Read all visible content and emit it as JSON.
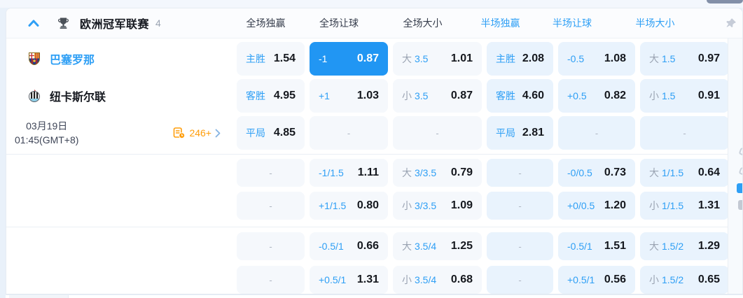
{
  "colors": {
    "accent_blue": "#2E9FF5",
    "selected_cell_bg": "#2196F3",
    "full_cell_bg": "#F5F8FC",
    "half_cell_bg": "#E9F3FD",
    "odds_text": "#15181E",
    "gray_label": "#9AA3B2",
    "orange": "#FF9D0A"
  },
  "league_header": {
    "title": "欧洲冠军联赛",
    "count": "4",
    "columns": [
      {
        "label": "全场独赢"
      },
      {
        "label": "全场让球"
      },
      {
        "label": "全场大小"
      },
      {
        "label": "半场独赢"
      },
      {
        "label": "半场让球"
      },
      {
        "label": "半场大小"
      }
    ]
  },
  "match": {
    "home_team": "巴塞罗那",
    "away_team": "纽卡斯尔联",
    "date": "03月19日",
    "time": "01:45(GMT+8)",
    "more_markets": "246+"
  },
  "odds": {
    "groups": [
      {
        "rows": [
          {
            "cells": [
              {
                "label": "主胜",
                "odds": "1.54"
              },
              {
                "label": "-1",
                "odds": "0.87",
                "selected": true
              },
              {
                "prefix": "大",
                "line": "3.5",
                "odds": "1.01"
              },
              {
                "label": "主胜",
                "odds": "2.08"
              },
              {
                "label": "-0.5",
                "odds": "1.08"
              },
              {
                "prefix": "大",
                "line": "1.5",
                "odds": "0.97"
              }
            ]
          },
          {
            "cells": [
              {
                "label": "客胜",
                "odds": "4.95"
              },
              {
                "label": "+1",
                "odds": "1.03"
              },
              {
                "prefix": "小",
                "line": "3.5",
                "odds": "0.87"
              },
              {
                "label": "客胜",
                "odds": "4.60"
              },
              {
                "label": "+0.5",
                "odds": "0.82"
              },
              {
                "prefix": "小",
                "line": "1.5",
                "odds": "0.91"
              }
            ]
          },
          {
            "cells": [
              {
                "label": "平局",
                "odds": "4.85"
              },
              {
                "dash": "-"
              },
              {
                "dash": "-"
              },
              {
                "label": "平局",
                "odds": "2.81"
              },
              {
                "dash": "-"
              },
              {
                "dash": "-"
              }
            ]
          }
        ]
      },
      {
        "rows": [
          {
            "cells": [
              {
                "dash": "-"
              },
              {
                "label": "-1/1.5",
                "odds": "1.11"
              },
              {
                "prefix": "大",
                "line": "3/3.5",
                "odds": "0.79"
              },
              {
                "dash": "-"
              },
              {
                "label": "-0/0.5",
                "odds": "0.73"
              },
              {
                "prefix": "大",
                "line": "1/1.5",
                "odds": "0.64"
              }
            ]
          },
          {
            "cells": [
              {
                "dash": "-"
              },
              {
                "label": "+1/1.5",
                "odds": "0.80"
              },
              {
                "prefix": "小",
                "line": "3/3.5",
                "odds": "1.09"
              },
              {
                "dash": "-"
              },
              {
                "label": "+0/0.5",
                "odds": "1.20"
              },
              {
                "prefix": "小",
                "line": "1/1.5",
                "odds": "1.31"
              }
            ]
          }
        ]
      },
      {
        "rows": [
          {
            "cells": [
              {
                "dash": "-"
              },
              {
                "label": "-0.5/1",
                "odds": "0.66"
              },
              {
                "prefix": "大",
                "line": "3.5/4",
                "odds": "1.25"
              },
              {
                "dash": "-"
              },
              {
                "label": "-0.5/1",
                "odds": "1.51"
              },
              {
                "prefix": "大",
                "line": "1.5/2",
                "odds": "1.29"
              }
            ]
          },
          {
            "cells": [
              {
                "dash": "-"
              },
              {
                "label": "+0.5/1",
                "odds": "1.31"
              },
              {
                "prefix": "小",
                "line": "3.5/4",
                "odds": "0.68"
              },
              {
                "dash": "-"
              },
              {
                "label": "+0.5/1",
                "odds": "0.56"
              },
              {
                "prefix": "小",
                "line": "1.5/2",
                "odds": "0.65"
              }
            ]
          }
        ]
      }
    ]
  }
}
